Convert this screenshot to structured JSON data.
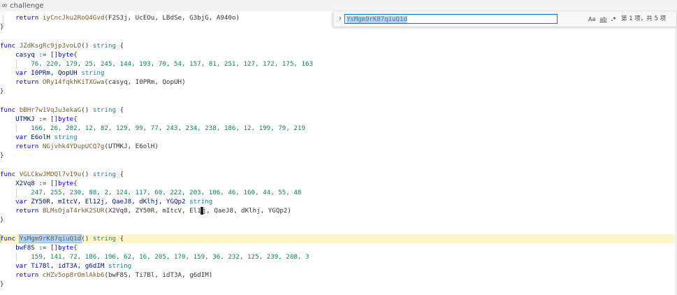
{
  "tab": {
    "icon": "infinity-icon",
    "label": "challenge"
  },
  "find": {
    "toggle": "›",
    "query": "YsMgm9rK87qiuQ1d",
    "opt_case": "Aa",
    "opt_word": "ab",
    "opt_regex": ".*",
    "count": "第 1 项，共 5 项"
  },
  "code": {
    "l0": "F2S3j, UcEOu, LBdSe, G3bjG, A940o)",
    "l0_ret": "iyCncJku2RoQ4Gvd",
    "f1": {
      "name": "JZdKsgRc9jp3voLO",
      "var": "casyq",
      "nums": "76, 220, 179, 25, 245, 144, 193, 70, 54, 157, 81, 251, 127, 172, 175, 163",
      "v2": "I0PRm, QopUH",
      "ret": "ORy14fqkhKiTXGwa",
      "args": "casyq, I0PRm, QopUH"
    },
    "f2": {
      "name": "bBHr7w1VqJu3ekaG",
      "var": "UTMKJ",
      "nums": "166, 26, 202, 12, 82, 129, 99, 77, 243, 234, 238, 186, 12, 199, 79, 219",
      "v2": "E6olH",
      "ret": "NGjvhk4YDupUCQ7g",
      "args": "UTMKJ, E6olH"
    },
    "f3": {
      "name": "VGLCkwJMDQl7vI9u",
      "var": "X2Vq8",
      "nums": "247, 255, 230, 88, 2, 124, 117, 60, 222, 203, 106, 46, 160, 44, 55, 48",
      "v2": "ZY50R, mItcV, El12j, QaeJ8, dKlhj, YGQp2",
      "ret": "BLMsOjaT4rkK2SUR",
      "args_a": "X2Vq8, ZY50R, mItcV, El1",
      "args_b": "j, QaeJ8, dKlhj, YGQp2"
    },
    "f4": {
      "name": "YsMgm9rK87qiuQ1d",
      "var": "bwF8S",
      "nums": "159, 141, 72, 106, 196, 62, 16, 205, 170, 159, 36, 232, 125, 239, 208, 3",
      "v2": "Ti7Bl, idT3A, g6dIM",
      "ret": "cHZv5op8rOmlAkb6",
      "args": "bwF8S, Ti7Bl, idT3A, g6dIM"
    },
    "kw_func": "func",
    "kw_var": "var",
    "kw_return": "return",
    "ty_string": "string",
    "op_bytes": ":= []",
    "ty_byte": "byte",
    "open_paren": "() ",
    "brace_open": "{",
    "brace_close": "}",
    "args_close": ")"
  },
  "colors": {
    "keyword": "#0000ff",
    "function": "#795e26",
    "type": "#267f99",
    "number": "#098658",
    "highlight": "#fdf7c8"
  }
}
